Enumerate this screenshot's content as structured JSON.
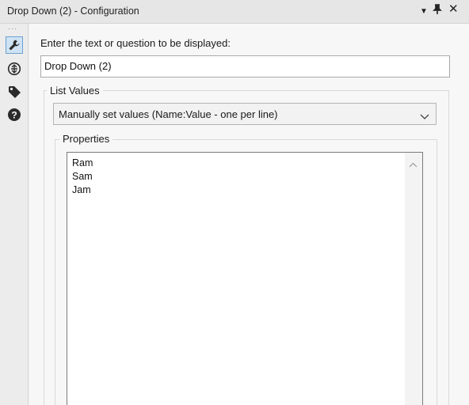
{
  "window": {
    "title": "Drop Down (2) - Configuration",
    "menu_glyph": "▾",
    "pin_glyph": "📌",
    "close_glyph": "✕"
  },
  "sidebar": {
    "items": [
      {
        "name": "configuration",
        "icon": "wrench-icon",
        "active": true
      },
      {
        "name": "layout",
        "icon": "layout-icon",
        "active": false
      },
      {
        "name": "annotation",
        "icon": "tag-icon",
        "active": false
      },
      {
        "name": "help",
        "icon": "help-icon",
        "active": false
      }
    ],
    "accent": "#6d9fd0"
  },
  "config": {
    "prompt_label": "Enter the text or question to be displayed:",
    "prompt_value": "Drop Down (2)",
    "list_values_label": "List Values",
    "list_mode": "Manually set values (Name:Value - one per line)",
    "properties_label": "Properties",
    "values": [
      "Ram",
      "Sam",
      "Jam"
    ]
  }
}
